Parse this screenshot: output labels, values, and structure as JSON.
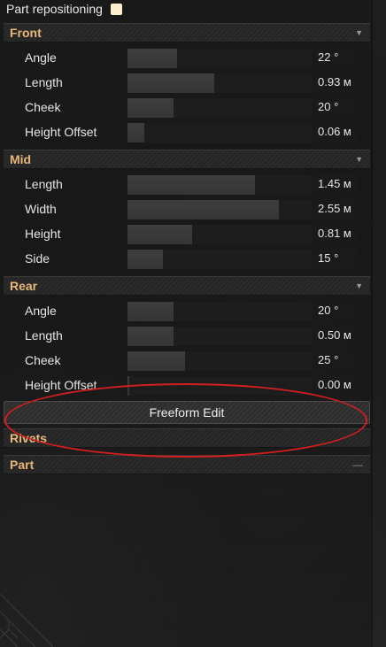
{
  "header": {
    "part_repositioning_label": "Part repositioning",
    "part_repositioning_checked": true
  },
  "sections": {
    "front": {
      "title": "Front",
      "collapsed": false,
      "rows": [
        {
          "label": "Angle",
          "value": "22 °",
          "level": 0.27
        },
        {
          "label": "Length",
          "value": "0.93 м",
          "level": 0.47
        },
        {
          "label": "Cheek",
          "value": "20 °",
          "level": 0.25
        },
        {
          "label": "Height Offset",
          "value": "0.06 м",
          "level": 0.09
        }
      ]
    },
    "mid": {
      "title": "Mid",
      "collapsed": false,
      "rows": [
        {
          "label": "Length",
          "value": "1.45 м",
          "level": 0.69
        },
        {
          "label": "Width",
          "value": "2.55 м",
          "level": 0.82
        },
        {
          "label": "Height",
          "value": "0.81 м",
          "level": 0.35
        },
        {
          "label": "Side",
          "value": "15 °",
          "level": 0.19
        }
      ]
    },
    "rear": {
      "title": "Rear",
      "collapsed": false,
      "rows": [
        {
          "label": "Angle",
          "value": "20 °",
          "level": 0.25
        },
        {
          "label": "Length",
          "value": "0.50 м",
          "level": 0.25
        },
        {
          "label": "Cheek",
          "value": "25 °",
          "level": 0.31
        },
        {
          "label": "Height Offset",
          "value": "0.00 м",
          "level": 0.01
        }
      ]
    },
    "rivets": {
      "title": "Rivets",
      "collapsed": true
    },
    "part": {
      "title": "Part",
      "collapsed": false
    }
  },
  "buttons": {
    "freeform_edit_label": "Freeform Edit"
  },
  "colors": {
    "section_title": "#e8b77a",
    "annotation_ring": "#d11f1f",
    "checkbox_fill": "#fdeecf"
  }
}
